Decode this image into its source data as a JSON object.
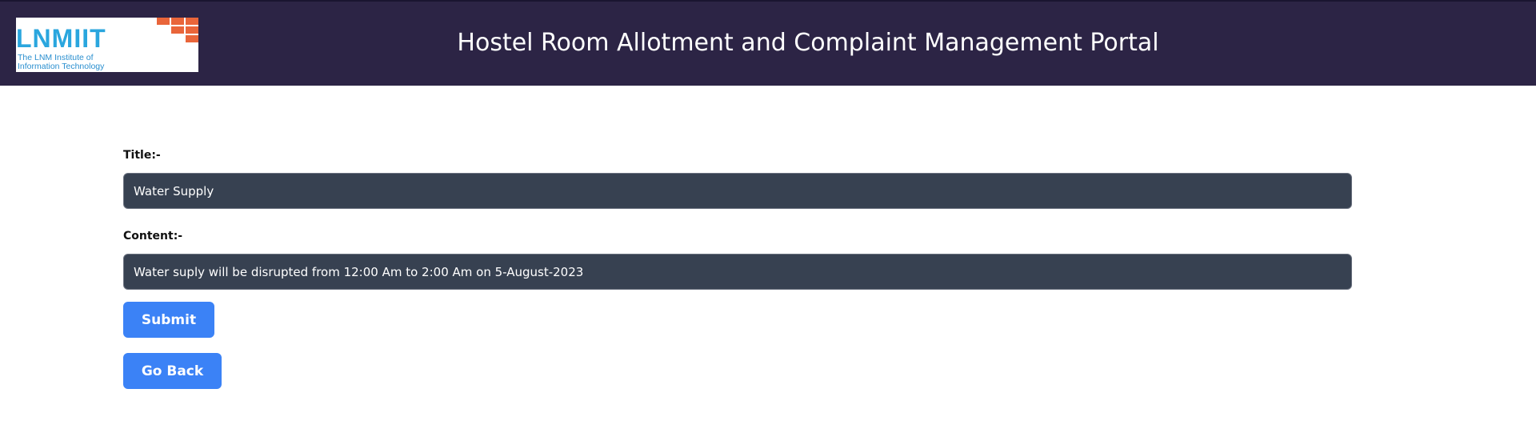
{
  "header": {
    "logo": {
      "wordmark": "LNMIIT",
      "subtitle_line1": "The LNM Institute of",
      "subtitle_line2": "Information Technology"
    },
    "title": "Hostel Room Allotment and Complaint Management Portal"
  },
  "form": {
    "title_label": "Title:-",
    "title_value": "Water Supply",
    "content_label": "Content:-",
    "content_value": "Water suply will be disrupted from 12:00 Am to 2:00 Am on 5-August-2023",
    "submit_label": "Submit",
    "back_label": "Go Back"
  },
  "colors": {
    "header_bg": "#2c2445",
    "input_bg": "#374151",
    "button_bg": "#3b82f6",
    "logo_blue": "#2aa6de",
    "logo_orange": "#e9653a"
  }
}
